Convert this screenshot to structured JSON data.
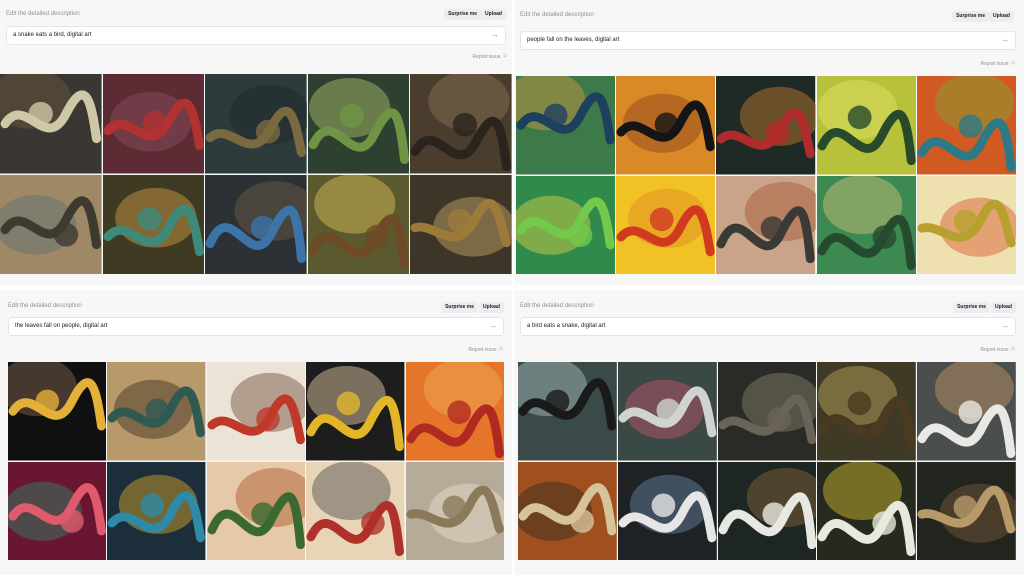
{
  "panels": [
    {
      "id": "top-left",
      "label": "Edit the detailed description",
      "surprise_label": "Surprise me",
      "upload_label": "Upload",
      "prompt": "a snake eats a bird, digital art",
      "report_label": "Report issue",
      "tiles": [
        {
          "bg": "#3a3631",
          "fg": "#cfc8a7",
          "accent": "#6b5a3c"
        },
        {
          "bg": "#5d2b33",
          "fg": "#b23232",
          "accent": "#8a5060"
        },
        {
          "bg": "#2d3b3d",
          "fg": "#7a6a40",
          "accent": "#1c2628"
        },
        {
          "bg": "#2e4030",
          "fg": "#6f9445",
          "accent": "#b3c56c"
        },
        {
          "bg": "#4a3d2e",
          "fg": "#2a241c",
          "accent": "#8c7655"
        },
        {
          "bg": "#9e8866",
          "fg": "#3f3a30",
          "accent": "#5b7075"
        },
        {
          "bg": "#3f3a22",
          "fg": "#3e8a7a",
          "accent": "#d7a14a"
        },
        {
          "bg": "#2b3134",
          "fg": "#3c74a8",
          "accent": "#6e5e48"
        },
        {
          "bg": "#5a5a2e",
          "fg": "#6e4a28",
          "accent": "#e3c05c"
        },
        {
          "bg": "#3d3528",
          "fg": "#9c7a3a",
          "accent": "#c9a96a"
        }
      ]
    },
    {
      "id": "top-right",
      "label": "Edit the detailed description",
      "surprise_label": "Surprise me",
      "upload_label": "Upload",
      "prompt": "people fall on the leaves, digital art",
      "report_label": "Report issue",
      "tiles": [
        {
          "bg": "#3c7a4a",
          "fg": "#1d4060",
          "accent": "#d89a3c"
        },
        {
          "bg": "#d98a26",
          "fg": "#151515",
          "accent": "#8a3f1e"
        },
        {
          "bg": "#1f2a27",
          "fg": "#b02b2b",
          "accent": "#c87a2e"
        },
        {
          "bg": "#b7c23a",
          "fg": "#284a2a",
          "accent": "#e7e26a"
        },
        {
          "bg": "#d05a22",
          "fg": "#2d7a86",
          "accent": "#7aa836"
        },
        {
          "bg": "#2f8a4c",
          "fg": "#73c94a",
          "accent": "#e2d244"
        },
        {
          "bg": "#f0c226",
          "fg": "#d23a20",
          "accent": "#e08a24"
        },
        {
          "bg": "#c9a48a",
          "fg": "#3a3a36",
          "accent": "#a4512e"
        },
        {
          "bg": "#3c8a52",
          "fg": "#254a2e",
          "accent": "#d6c07a"
        },
        {
          "bg": "#efe0b0",
          "fg": "#b7a12e",
          "accent": "#d8552a"
        }
      ]
    },
    {
      "id": "bottom-left",
      "label": "Edit the detailed description",
      "surprise_label": "Surprise me",
      "upload_label": "Upload",
      "prompt": "the leaves fall on people, digital art",
      "report_label": "Report issue",
      "tiles": [
        {
          "bg": "#101010",
          "fg": "#e3b03a",
          "accent": "#8a6a52"
        },
        {
          "bg": "#b89a6a",
          "fg": "#2f5a52",
          "accent": "#3a2a1e"
        },
        {
          "bg": "#ebe3d6",
          "fg": "#c0382a",
          "accent": "#6a4a38"
        },
        {
          "bg": "#1d1d1d",
          "fg": "#e3b62a",
          "accent": "#f0d6b0"
        },
        {
          "bg": "#e4752a",
          "fg": "#b12a22",
          "accent": "#f2b05a"
        },
        {
          "bg": "#6a1630",
          "fg": "#e05a6e",
          "accent": "#2d8a6a"
        },
        {
          "bg": "#1c2e3a",
          "fg": "#2e8aa6",
          "accent": "#e0aa2a"
        },
        {
          "bg": "#e6c9a8",
          "fg": "#3a6a32",
          "accent": "#a8552a"
        },
        {
          "bg": "#e8d4b6",
          "fg": "#b0302a",
          "accent": "#4a4a4a"
        },
        {
          "bg": "#b6aa98",
          "fg": "#8a7a5a",
          "accent": "#eae2d0"
        }
      ]
    },
    {
      "id": "bottom-right",
      "label": "Edit the detailed description",
      "surprise_label": "Surprise me",
      "upload_label": "Upload",
      "prompt": "a bird eats a snake, digital art",
      "report_label": "Report issue",
      "tiles": [
        {
          "bg": "#3a4a48",
          "fg": "#1a1a1a",
          "accent": "#b0c0c4"
        },
        {
          "bg": "#3a4846",
          "fg": "#d0d4d0",
          "accent": "#c9566a"
        },
        {
          "bg": "#2a2a26",
          "fg": "#6a6458",
          "accent": "#8a8470"
        },
        {
          "bg": "#3e3a26",
          "fg": "#4a3a22",
          "accent": "#c2ae62"
        },
        {
          "bg": "#4a4e4c",
          "fg": "#e8e8e4",
          "accent": "#c59a66"
        },
        {
          "bg": "#a0501e",
          "fg": "#d7c39a",
          "accent": "#2a2a22"
        },
        {
          "bg": "#1e2224",
          "fg": "#e6e6e6",
          "accent": "#6a8aa6"
        },
        {
          "bg": "#1e2624",
          "fg": "#e8e8e2",
          "accent": "#8a6a3a"
        },
        {
          "bg": "#262a1e",
          "fg": "#e8e8dc",
          "accent": "#d6c230"
        },
        {
          "bg": "#22241e",
          "fg": "#b89a6a",
          "accent": "#7a5a3a"
        }
      ]
    }
  ]
}
